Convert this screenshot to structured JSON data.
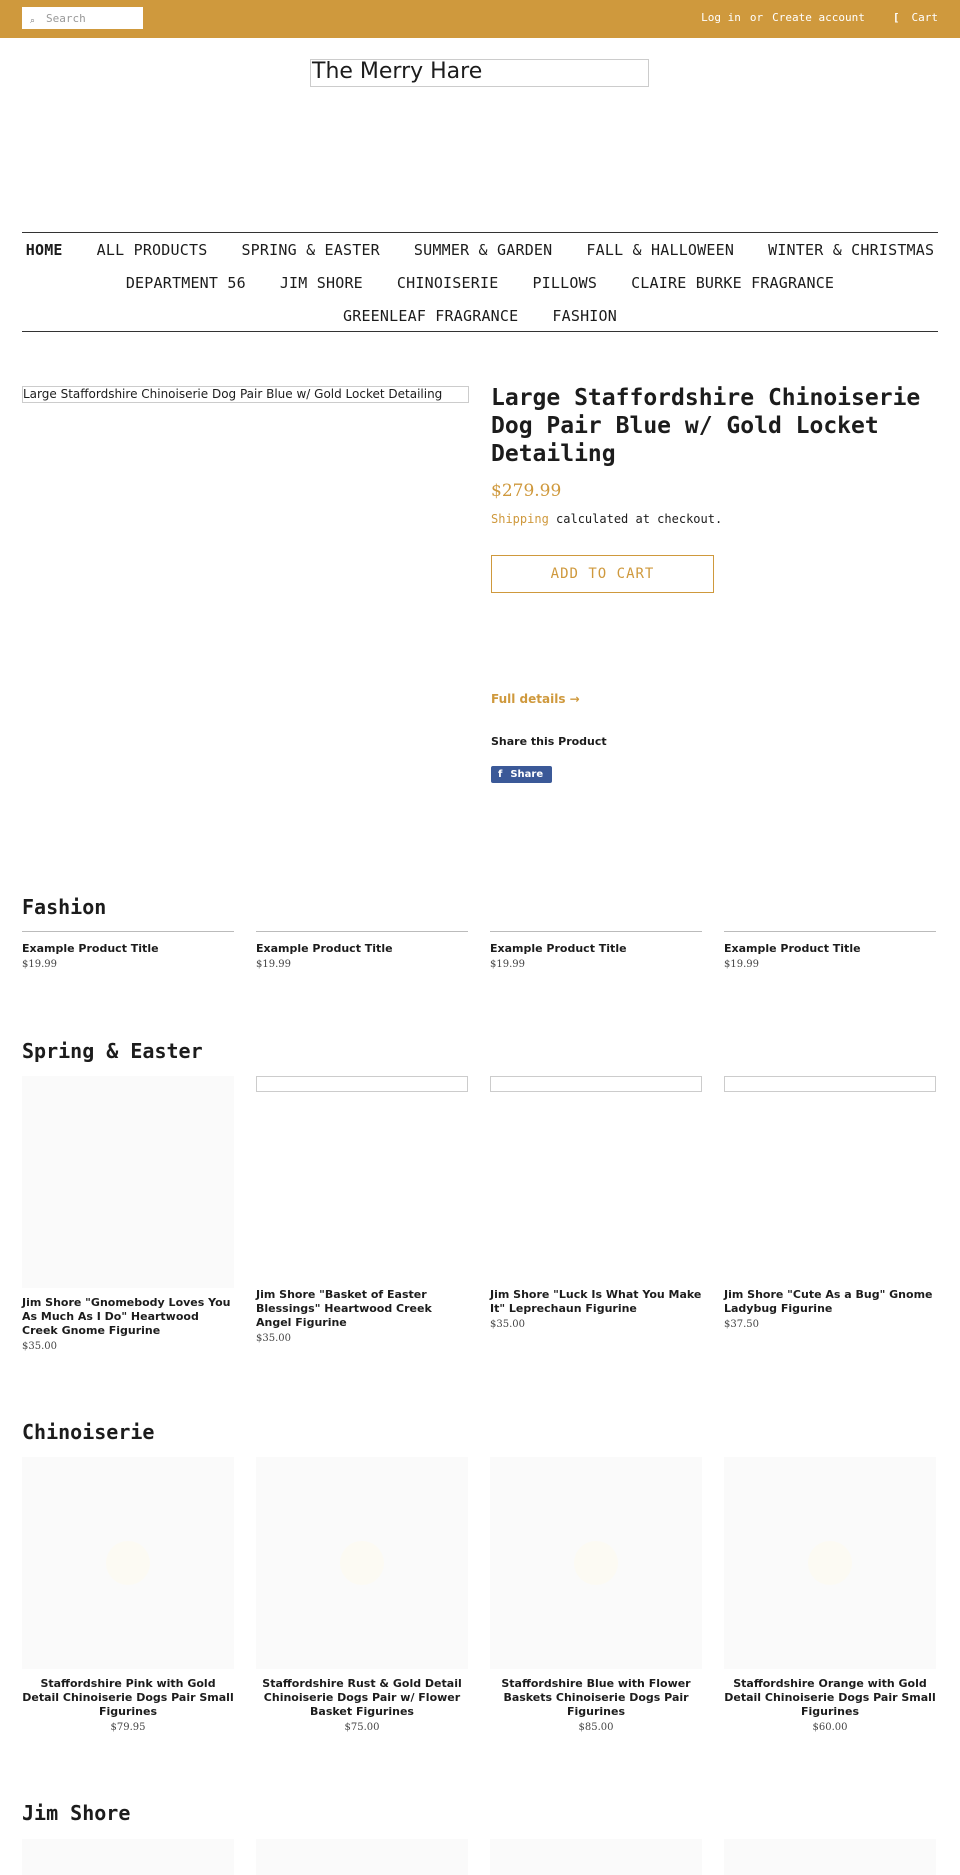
{
  "topbar": {
    "search_placeholder": "Search",
    "login": "Log in",
    "or": "or",
    "create_account": "Create account",
    "cart_icon_glyph": "[",
    "cart": "Cart",
    "color": "#cf993d"
  },
  "logo": {
    "text": "The Merry Hare"
  },
  "nav": {
    "row1": [
      "HOME",
      "ALL PRODUCTS",
      "SPRING & EASTER",
      "SUMMER & GARDEN",
      "FALL & HALLOWEEN",
      "WINTER & CHRISTMAS"
    ],
    "row2": [
      "DEPARTMENT 56",
      "JIM SHORE",
      "CHINOISERIE",
      "PILLOWS",
      "CLAIRE BURKE FRAGRANCE"
    ],
    "row3": [
      "GREENLEAF FRAGRANCE",
      "FASHION"
    ]
  },
  "product": {
    "image_alt": "Large Staffordshire Chinoiserie Dog Pair Blue w/ Gold Locket Detailing",
    "title": "Large Staffordshire Chinoiserie Dog Pair Blue w/ Gold Locket Detailing",
    "price": "$279.99",
    "shipping_link": "Shipping",
    "shipping_text": " calculated at checkout.",
    "add_to_cart": "ADD TO CART",
    "full_details": "Full details →",
    "share_heading": "Share this Product",
    "share_icon": "f",
    "share_label": "Share"
  },
  "sections": {
    "fashion": {
      "title": "Fashion",
      "items": [
        {
          "title": "Example Product Title",
          "price": "$19.99"
        },
        {
          "title": "Example Product Title",
          "price": "$19.99"
        },
        {
          "title": "Example Product Title",
          "price": "$19.99"
        },
        {
          "title": "Example Product Title",
          "price": "$19.99"
        }
      ]
    },
    "spring": {
      "title": "Spring & Easter",
      "items": [
        {
          "title": "Jim Shore \"Gnomebody Loves You As Much As I Do\" Heartwood Creek Gnome Figurine",
          "price": "$35.00"
        },
        {
          "title": "Jim Shore \"Basket of Easter Blessings\" Heartwood Creek Angel Figurine",
          "price": "$35.00"
        },
        {
          "title": "Jim Shore \"Luck Is What You Make It\" Leprechaun Figurine",
          "price": "$35.00"
        },
        {
          "title": "Jim Shore \"Cute As a Bug\" Gnome Ladybug Figurine",
          "price": "$37.50"
        }
      ]
    },
    "chinoiserie": {
      "title": "Chinoiserie",
      "items": [
        {
          "title": "Staffordshire Pink with Gold Detail Chinoiserie Dogs Pair Small Figurines",
          "price": "$79.95"
        },
        {
          "title": "Staffordshire Rust & Gold Detail Chinoiserie Dogs Pair w/ Flower Basket Figurines",
          "price": "$75.00"
        },
        {
          "title": "Staffordshire Blue with Flower Baskets Chinoiserie Dogs Pair Figurines",
          "price": "$85.00"
        },
        {
          "title": "Staffordshire Orange with Gold Detail Chinoiserie Dogs Pair Small Figurines",
          "price": "$60.00"
        }
      ]
    },
    "jimshore": {
      "title": "Jim Shore"
    }
  }
}
